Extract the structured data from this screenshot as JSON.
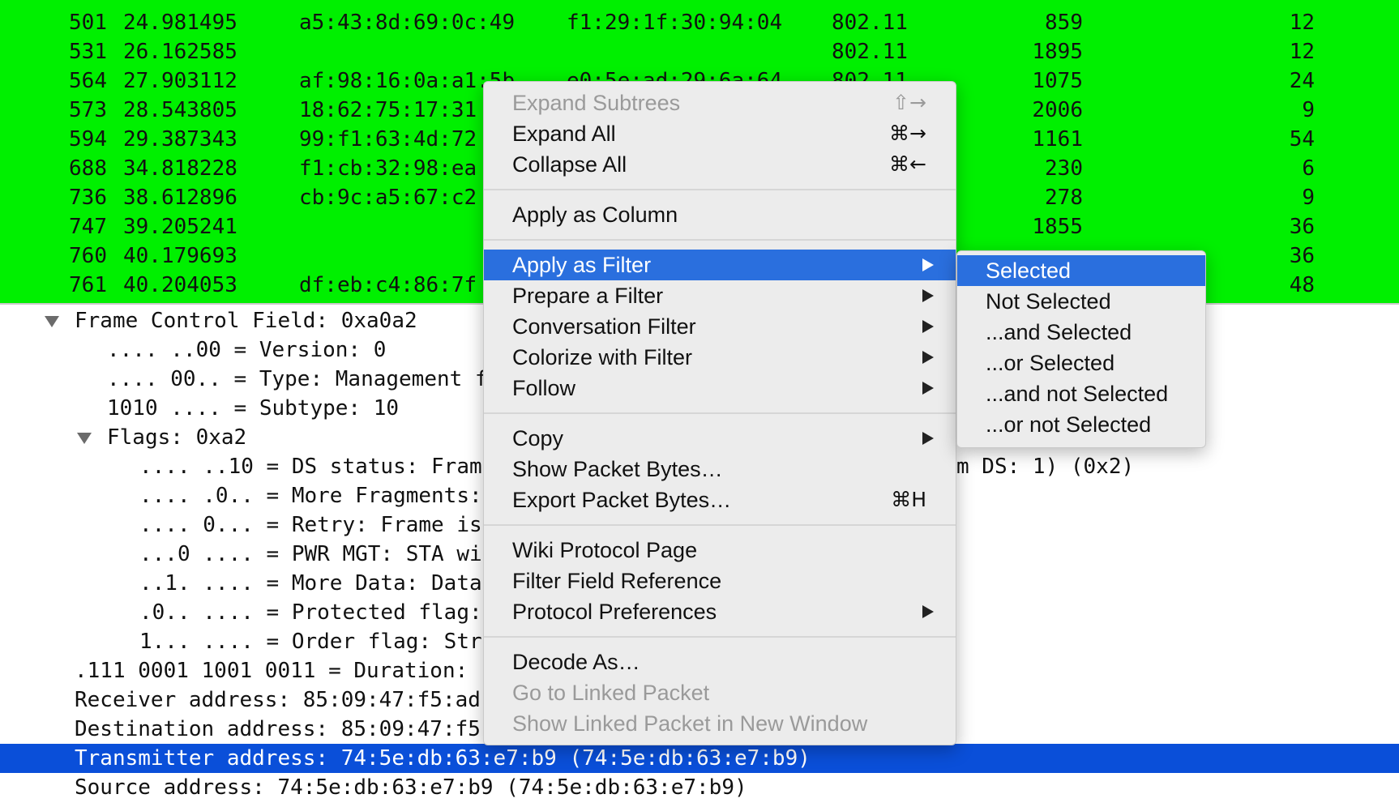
{
  "colors": {
    "packet_list_bg": "#00f000",
    "selection_blue": "#0a4fd9",
    "menu_highlight": "#2a6fde",
    "menu_bg": "#ececec",
    "disabled_text": "#9a9a9a"
  },
  "packet_list": {
    "rows": [
      {
        "no": "501",
        "time": "24.981495",
        "src": "a5:43:8d:69:0c:49",
        "dst": "f1:29:1f:30:94:04",
        "proto": "802.11",
        "len": "859",
        "info": "12"
      },
      {
        "no": "531",
        "time": "26.162585",
        "src": "",
        "dst": "",
        "proto": "802.11",
        "len": "1895",
        "info": "12"
      },
      {
        "no": "564",
        "time": "27.903112",
        "src": "af:98:16:0a:a1:5b",
        "dst": "e0:5e:ad:29:6a:64",
        "proto": "802.11",
        "len": "1075",
        "info": "24"
      },
      {
        "no": "573",
        "time": "28.543805",
        "src": "18:62:75:17:31",
        "dst": "",
        "proto": "",
        "len": "2006",
        "info": "9"
      },
      {
        "no": "594",
        "time": "29.387343",
        "src": "99:f1:63:4d:72",
        "dst": "",
        "proto": "",
        "len": "1161",
        "info": "54"
      },
      {
        "no": "688",
        "time": "34.818228",
        "src": "f1:cb:32:98:ea",
        "dst": "",
        "proto": "",
        "len": "230",
        "info": "6"
      },
      {
        "no": "736",
        "time": "38.612896",
        "src": "cb:9c:a5:67:c2",
        "dst": "",
        "proto": "",
        "len": "278",
        "info": "9"
      },
      {
        "no": "747",
        "time": "39.205241",
        "src": "",
        "dst": "",
        "proto": "",
        "len": "1855",
        "info": "36"
      },
      {
        "no": "760",
        "time": "40.179693",
        "src": "",
        "dst": "",
        "proto": "",
        "len": "",
        "info": "36"
      },
      {
        "no": "761",
        "time": "40.204053",
        "src": "df:eb:c4:86:7f",
        "dst": "",
        "proto": "",
        "len": "",
        "info": "48"
      }
    ]
  },
  "detail_tree": {
    "rows": [
      {
        "text": "Frame Control Field: 0xa0a2",
        "expander": true
      },
      {
        "text": ".... ..00 = Version: 0",
        "expander": false
      },
      {
        "text": ".... 00.. = Type: Management f",
        "expander": false
      },
      {
        "text": "1010 .... = Subtype: 10",
        "expander": false
      },
      {
        "text": "Flags: 0xa2",
        "expander": true
      },
      {
        "text": ".... ..10 = DS status: Fram",
        "expander": false
      },
      {
        "text": ".... .0.. = More Fragments:",
        "expander": false
      },
      {
        "text": ".... 0... = Retry: Frame is",
        "expander": false
      },
      {
        "text": "...0 .... = PWR MGT: STA wi",
        "expander": false
      },
      {
        "text": "..1. .... = More Data: Data",
        "expander": false
      },
      {
        "text": ".0.. .... = Protected flag:",
        "expander": false
      },
      {
        "text": "1... .... = Order flag: Str",
        "expander": false
      },
      {
        "text": ".111 0001 1001 0011 = Duration:",
        "expander": false
      },
      {
        "text": "Receiver address: 85:09:47:f5:ad",
        "expander": false
      },
      {
        "text": "Destination address: 85:09:47:f5",
        "expander": false
      },
      {
        "text": "Transmitter address: 74:5e:db:63:e7:b9 (74:5e:db:63:e7:b9)",
        "expander": false
      },
      {
        "text": "Source address: 74:5e:db:63:e7:b9 (74:5e:db:63:e7:b9)",
        "expander": false
      }
    ],
    "ds_status_tail": "m DS: 1) (0x2)",
    "selected_row": "Transmitter address: 74:5e:db:63:e7:b9 (74:5e:db:63:e7:b9)"
  },
  "context_menu": {
    "items": [
      {
        "label": "Expand Subtrees",
        "shortcut": "⇧→",
        "disabled": true
      },
      {
        "label": "Expand All",
        "shortcut": "⌘→"
      },
      {
        "label": "Collapse All",
        "shortcut": "⌘←"
      },
      {
        "label": "Apply as Column"
      },
      {
        "label": "Apply as Filter",
        "submenu": true,
        "highlighted": true
      },
      {
        "label": "Prepare a Filter",
        "submenu": true
      },
      {
        "label": "Conversation Filter",
        "submenu": true
      },
      {
        "label": "Colorize with Filter",
        "submenu": true
      },
      {
        "label": "Follow",
        "submenu": true
      },
      {
        "label": "Copy",
        "submenu": true
      },
      {
        "label": "Show Packet Bytes…"
      },
      {
        "label": "Export Packet Bytes…",
        "shortcut": "⌘H"
      },
      {
        "label": "Wiki Protocol Page"
      },
      {
        "label": "Filter Field Reference"
      },
      {
        "label": "Protocol Preferences",
        "submenu": true
      },
      {
        "label": "Decode As…"
      },
      {
        "label": "Go to Linked Packet",
        "disabled": true
      },
      {
        "label": "Show Linked Packet in New Window",
        "disabled": true
      }
    ]
  },
  "apply_as_filter_submenu": {
    "items": [
      {
        "label": "Selected",
        "highlighted": true
      },
      {
        "label": "Not Selected"
      },
      {
        "label": "...and Selected"
      },
      {
        "label": "...or Selected"
      },
      {
        "label": "...and not Selected"
      },
      {
        "label": "...or not Selected"
      }
    ]
  }
}
